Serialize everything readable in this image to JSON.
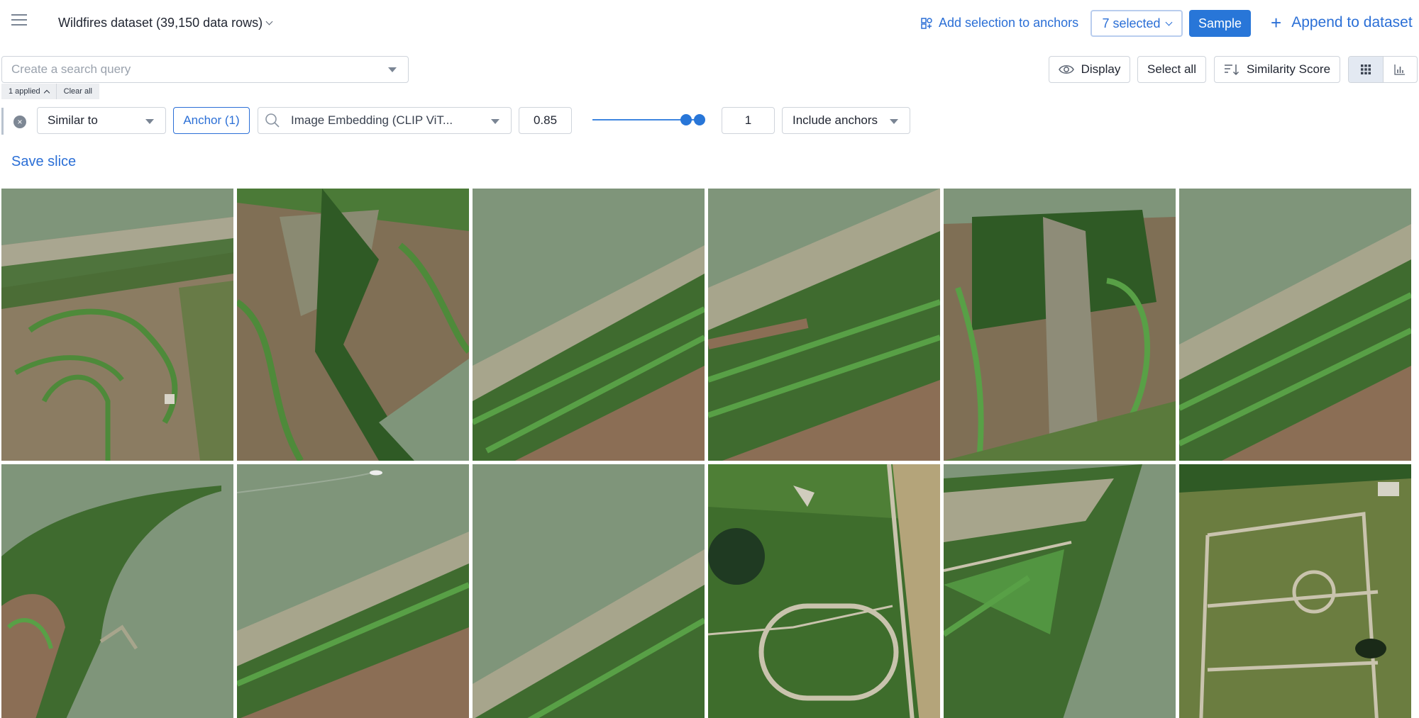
{
  "header": {
    "dataset_title": "Wildfires dataset (39,150 data rows)",
    "add_to_anchors": "Add selection to anchors",
    "selected": "7 selected",
    "sample": "Sample",
    "append": "Append to dataset"
  },
  "search": {
    "placeholder": "Create a search query",
    "value": ""
  },
  "applied_filters": {
    "applied_label": "1 applied",
    "clear_all": "Clear all"
  },
  "toolbar": {
    "display": "Display",
    "select_all": "Select all",
    "sort_by": "Similarity Score",
    "view_mode": "grid"
  },
  "filter": {
    "operator": "Similar to",
    "anchor": "Anchor (1)",
    "embedding": "Image Embedding (CLIP ViT...",
    "threshold": "0.85",
    "slider_value_fraction": 0.88,
    "count": "1",
    "include": "Include anchors"
  },
  "save_slice": "Save slice",
  "images": [
    {
      "scene": "farm-river-1"
    },
    {
      "scene": "farm-river-2"
    },
    {
      "scene": "river-bank-1"
    },
    {
      "scene": "river-bank-2"
    },
    {
      "scene": "farm-river-3"
    },
    {
      "scene": "river-bank-3"
    },
    {
      "scene": "peninsula"
    },
    {
      "scene": "river-boat"
    },
    {
      "scene": "river-bank-4"
    },
    {
      "scene": "racetrack"
    },
    {
      "scene": "river-bank-5"
    },
    {
      "scene": "field-paths"
    }
  ],
  "colors": {
    "accent": "#2876d8",
    "link": "#2b6fd6",
    "water": "#7d957a",
    "forest": "#3f6b2f",
    "field": "#8a7a5e"
  },
  "icons": {
    "menu": "hamburger-icon",
    "anchors": "add-anchor-icon",
    "display": "eye-icon",
    "sort": "sort-descending-icon",
    "grid_view": "grid-icon",
    "chart_view": "bar-chart-icon",
    "search": "magnifier-icon",
    "remove": "close-circle-icon"
  }
}
